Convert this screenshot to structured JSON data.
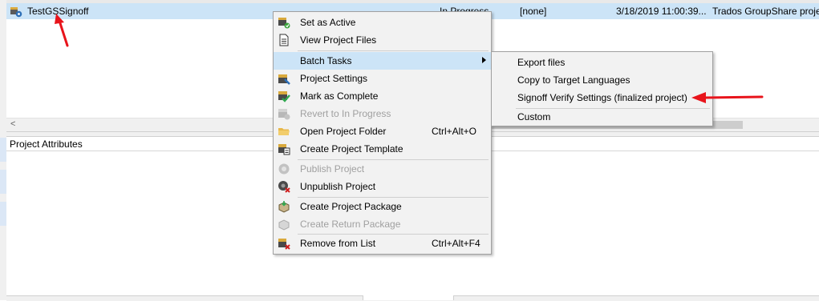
{
  "project_row": {
    "name": "TestGSSignoff",
    "status": "In Progress",
    "due": "[none]",
    "created": "3/18/2019  11:00:39...",
    "server": "Trados GroupShare project"
  },
  "scrollbar": {
    "left_arrow": "<"
  },
  "attributes_panel": {
    "title": "Project Attributes"
  },
  "context_menu": {
    "set_active": "Set as Active",
    "view_files": "View Project Files",
    "batch_tasks": "Batch Tasks",
    "project_settings": "Project Settings",
    "mark_complete": "Mark as Complete",
    "revert_progress": "Revert to In Progress",
    "open_folder": "Open Project Folder",
    "open_folder_shortcut": "Ctrl+Alt+O",
    "create_template": "Create Project Template",
    "publish": "Publish Project",
    "unpublish": "Unpublish Project",
    "create_package": "Create Project Package",
    "create_return": "Create Return Package",
    "remove": "Remove from List",
    "remove_shortcut": "Ctrl+Alt+F4"
  },
  "batch_submenu": {
    "export_files": "Export files",
    "copy_target": "Copy to Target Languages",
    "signoff": "Signoff Verify Settings (finalized project)",
    "custom": "Custom"
  },
  "colors": {
    "selection": "#cce4f7",
    "menu_bg": "#f2f2f2",
    "disabled_text": "#a0a0a0",
    "annotation_arrow": "#e8141b"
  },
  "icons": {
    "project_row": "project-server-icon",
    "set_active": "set-active-icon",
    "view_files": "document-icon",
    "project_settings": "settings-icon",
    "mark_complete": "checkmark-icon",
    "revert_progress": "revert-icon",
    "open_folder": "folder-icon",
    "create_template": "template-icon",
    "publish": "publish-icon",
    "unpublish": "unpublish-icon",
    "create_package": "package-icon",
    "create_return": "return-package-icon",
    "remove": "remove-icon"
  }
}
